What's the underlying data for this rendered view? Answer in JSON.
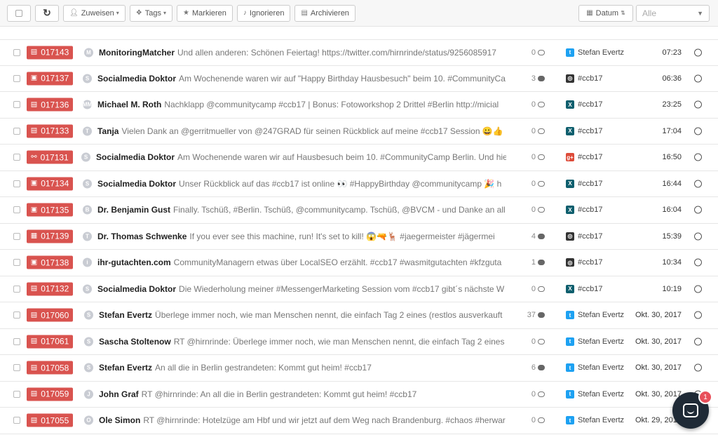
{
  "toolbar": {
    "assign_label": "Zuweisen",
    "tags_label": "Tags",
    "mark_label": "Markieren",
    "ignore_label": "Ignorieren",
    "archive_label": "Archivieren",
    "sort_label": "Datum",
    "filter_placeholder": "Alle"
  },
  "colors": {
    "ticket_badge": "#d9534f",
    "twitter": "#1da1f2",
    "xing": "#0f5f6e",
    "instagram": "#333333",
    "google_plus": "#dd4b39",
    "chat_launcher": "#1f2a36",
    "chat_badge": "#e8505b"
  },
  "rows": [
    {
      "ticket": "017143",
      "type_icon": "message-icon",
      "author": "MonitoringMatcher",
      "text": "Und allen anderen: Schönen Feiertag! https://twitter.com/hirnrinde/status/9256085917",
      "count": "0",
      "channel_icon": "twitter-icon",
      "channel": "Stefan Evertz",
      "time": "07:23",
      "avatar": "M"
    },
    {
      "ticket": "017137",
      "type_icon": "image-icon",
      "author": "Socialmedia Doktor",
      "text": "Am Wochenende waren wir auf \"Happy Birthday Hausbesuch\" beim 10. #CommunityCa",
      "count": "3",
      "channel_icon": "instagram-icon",
      "channel": "#ccb17",
      "time": "06:36",
      "avatar": "S"
    },
    {
      "ticket": "017136",
      "type_icon": "message-icon",
      "author": "Michael M. Roth",
      "text": "Nachklapp @communitycamp #ccb17 | Bonus: Fotoworkshop 2 Drittel #Berlin http://micial",
      "count": "0",
      "channel_icon": "xing-icon",
      "channel": "#ccb17",
      "time": "23:25",
      "avatar": "MM"
    },
    {
      "ticket": "017133",
      "type_icon": "message-icon",
      "author": "Tanja",
      "text": "Vielen Dank an @gerritmueller von @247GRAD für seinen Rückblick auf meine #ccb17 Session 😀👍",
      "count": "0",
      "channel_icon": "xing-icon",
      "channel": "#ccb17",
      "time": "17:04",
      "avatar": "T"
    },
    {
      "ticket": "017131",
      "type_icon": "link-icon",
      "author": "Socialmedia Doktor",
      "text": "Am Wochenende waren wir auf Hausbesuch beim 10. #CommunityCamp Berlin. Und hie",
      "count": "0",
      "channel_icon": "google-plus-icon",
      "channel": "#ccb17",
      "time": "16:50",
      "avatar": "S"
    },
    {
      "ticket": "017134",
      "type_icon": "image-icon",
      "author": "Socialmedia Doktor",
      "text": "Unser Rückblick auf das #ccb17 ist online 👀 #HappyBirthday @communitycamp 🎉 h",
      "count": "0",
      "channel_icon": "xing-icon",
      "channel": "#ccb17",
      "time": "16:44",
      "avatar": "S"
    },
    {
      "ticket": "017135",
      "type_icon": "image-icon",
      "author": "Dr. Benjamin Gust",
      "text": "Finally. Tschüß, #Berlin. Tschüß, @communitycamp. Tschüß, @BVCM - und Danke an all",
      "count": "0",
      "channel_icon": "xing-icon",
      "channel": "#ccb17",
      "time": "16:04",
      "avatar": "B"
    },
    {
      "ticket": "017139",
      "type_icon": "video-icon",
      "author": "Dr. Thomas Schwenke",
      "text": "If you ever see this machine, run! It's set to kill! 😱🔫🦌 #jaegermeister #jägermei",
      "count": "4",
      "channel_icon": "instagram-icon",
      "channel": "#ccb17",
      "time": "15:39",
      "avatar": "T"
    },
    {
      "ticket": "017138",
      "type_icon": "image-icon",
      "author": "ihr-gutachten.com",
      "text": "CommunityManagern etwas über LocalSEO erzählt. #ccb17 #wasmitgutachten #kfzguta",
      "count": "1",
      "channel_icon": "instagram-icon",
      "channel": "#ccb17",
      "time": "10:34",
      "avatar": "i"
    },
    {
      "ticket": "017132",
      "type_icon": "message-icon",
      "author": "Socialmedia Doktor",
      "text": "Die Wiederholung meiner #MessengerMarketing Session vom #ccb17 gibt´s nächste W",
      "count": "0",
      "channel_icon": "xing-icon",
      "channel": "#ccb17",
      "time": "10:19",
      "avatar": "S"
    },
    {
      "ticket": "017060",
      "type_icon": "message-icon",
      "author": "Stefan Evertz",
      "text": "Überlege immer noch, wie man Menschen nennt, die einfach Tag 2 eines (restlos ausverkauft",
      "count": "37",
      "channel_icon": "twitter-icon",
      "channel": "Stefan Evertz",
      "time": "Okt. 30, 2017",
      "avatar": "S"
    },
    {
      "ticket": "017061",
      "type_icon": "message-icon",
      "author": "Sascha Stoltenow",
      "text": "RT @hirnrinde: Überlege immer noch, wie man Menschen nennt, die einfach Tag 2 eines",
      "count": "0",
      "channel_icon": "twitter-icon",
      "channel": "Stefan Evertz",
      "time": "Okt. 30, 2017",
      "avatar": "S"
    },
    {
      "ticket": "017058",
      "type_icon": "message-icon",
      "author": "Stefan Evertz",
      "text": "An all die in Berlin gestrandeten: Kommt gut heim! #ccb17",
      "count": "6",
      "channel_icon": "twitter-icon",
      "channel": "Stefan Evertz",
      "time": "Okt. 30, 2017",
      "avatar": "S"
    },
    {
      "ticket": "017059",
      "type_icon": "message-icon",
      "author": "John Graf",
      "text": "RT @hirnrinde: An all die in Berlin gestrandeten: Kommt gut heim! #ccb17",
      "count": "0",
      "channel_icon": "twitter-icon",
      "channel": "Stefan Evertz",
      "time": "Okt. 30, 2017",
      "avatar": "J"
    },
    {
      "ticket": "017055",
      "type_icon": "message-icon",
      "author": "Ole Simon",
      "text": "RT @hirnrinde: Hotelzüge am Hbf und wir jetzt auf dem Weg nach Brandenburg. #chaos #herwar",
      "count": "0",
      "channel_icon": "twitter-icon",
      "channel": "Stefan Evertz",
      "time": "Okt. 29, 2017",
      "avatar": "O"
    }
  ],
  "chat": {
    "badge_count": "1"
  }
}
